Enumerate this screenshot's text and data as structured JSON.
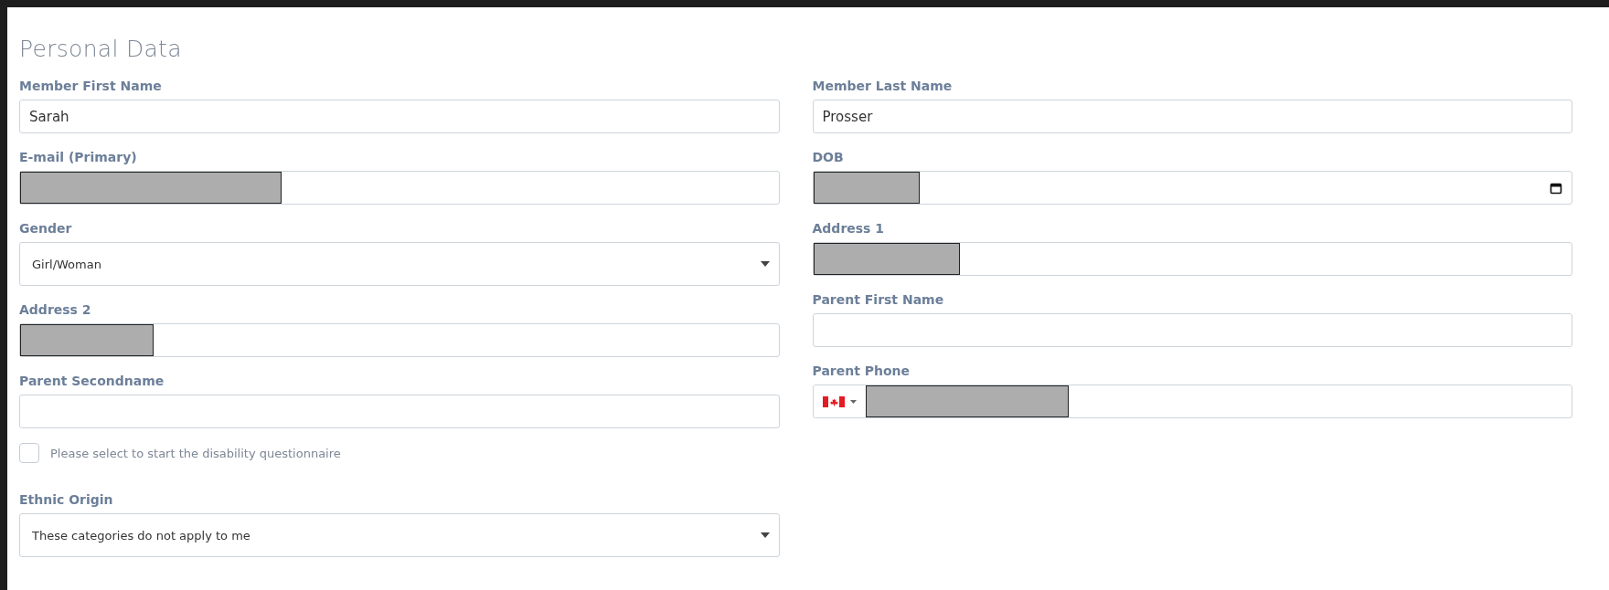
{
  "title": "Personal Data",
  "left": [
    {
      "kind": "text",
      "label": "Member First Name",
      "value": "Sarah",
      "redacted": false
    },
    {
      "kind": "text",
      "label": "E-mail (Primary)",
      "redacted": true
    },
    {
      "kind": "select",
      "label": "Gender",
      "value": "Girl/Woman"
    },
    {
      "kind": "text",
      "label": "Address 2",
      "redacted": true
    },
    {
      "kind": "text",
      "label": "Parent Secondname",
      "redacted": false
    },
    {
      "kind": "checkbox",
      "label": "Please select to start the disability questionnaire",
      "checked": false
    },
    {
      "kind": "select",
      "label": "Ethnic Origin",
      "value": "These categories do not apply to me"
    }
  ],
  "right": [
    {
      "kind": "text",
      "label": "Member Last Name",
      "value": "Prosser",
      "redacted": false
    },
    {
      "kind": "date",
      "label": "DOB",
      "redacted": true
    },
    {
      "kind": "text",
      "label": "Address 1",
      "redacted": true
    },
    {
      "kind": "text",
      "label": "Parent First Name",
      "redacted": false
    },
    {
      "kind": "phone",
      "label": "Parent Phone",
      "redacted": true
    }
  ]
}
